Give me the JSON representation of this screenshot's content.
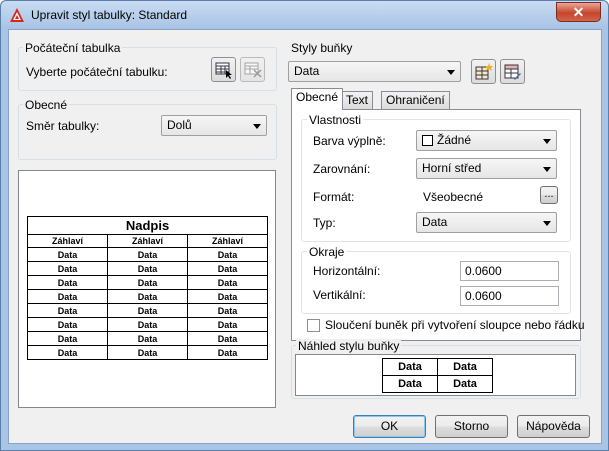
{
  "window": {
    "title": "Upravit styl tabulky: Standard",
    "close_symbol": "✕"
  },
  "start_table": {
    "group_label": "Počáteční tabulka",
    "select_label": "Vyberte počáteční tabulku:"
  },
  "general": {
    "group_label": "Obecné",
    "direction_label": "Směr tabulky:",
    "direction_value": "Dolů"
  },
  "preview": {
    "title": "Nadpis",
    "header_cell": "Záhlaví",
    "data_cell": "Data",
    "columns": 3,
    "data_rows": 8
  },
  "cell_styles": {
    "group_label": "Styly buňky",
    "selected": "Data"
  },
  "tabs": [
    {
      "label": "Obecné",
      "active": true
    },
    {
      "label": "Text",
      "active": false
    },
    {
      "label": "Ohraničení",
      "active": false
    }
  ],
  "properties": {
    "group_label": "Vlastnosti",
    "fill_label": "Barva výplně:",
    "fill_value": "Žádné",
    "align_label": "Zarovnání:",
    "align_value": "Horní střed",
    "format_label": "Formát:",
    "format_value": "Všeobecné",
    "format_button": "...",
    "type_label": "Typ:",
    "type_value": "Data"
  },
  "margins": {
    "group_label": "Okraje",
    "horizontal_label": "Horizontální:",
    "horizontal_value": "0.0600",
    "vertical_label": "Vertikální:",
    "vertical_value": "0.0600"
  },
  "merge": {
    "label": "Sloučení buněk při vytvoření sloupce nebo řádku",
    "checked": false
  },
  "cell_preview": {
    "group_label": "Náhled stylu buňky",
    "cell_text": "Data"
  },
  "buttons": {
    "ok": "OK",
    "cancel": "Storno",
    "help": "Nápověda"
  }
}
